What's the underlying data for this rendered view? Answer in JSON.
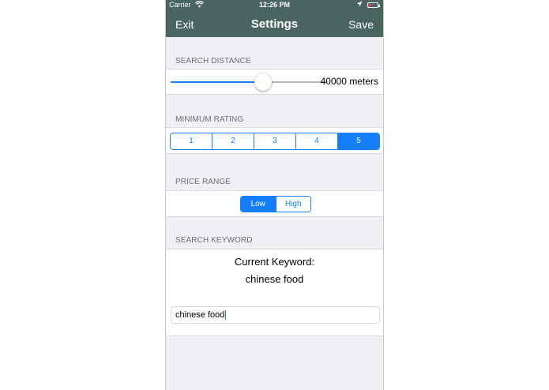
{
  "status_bar": {
    "carrier": "Carrier",
    "wifi_icon": "wifi-icon",
    "time": "12:26 PM",
    "location_icon": "location-arrow-icon",
    "battery_icon": "battery-low-icon",
    "battery_color": "#ff3b30"
  },
  "nav": {
    "exit_label": "Exit",
    "title": "Settings",
    "save_label": "Save",
    "bar_color": "#4a655f"
  },
  "search_distance": {
    "header": "SEARCH DISTANCE",
    "value_text": "40000 meters",
    "slider_fraction": 0.58,
    "accent_color": "#157efb"
  },
  "minimum_rating": {
    "header": "MINIMUM RATING",
    "options": [
      "1",
      "2",
      "3",
      "4",
      "5"
    ],
    "selected": "5"
  },
  "price_range": {
    "header": "PRICE RANGE",
    "options": [
      "Low",
      "High"
    ],
    "selected": "Low"
  },
  "search_keyword": {
    "header": "SEARCH KEYWORD",
    "current_label": "Current Keyword:",
    "current_value": "chinese food",
    "input_value": "chinese food"
  }
}
